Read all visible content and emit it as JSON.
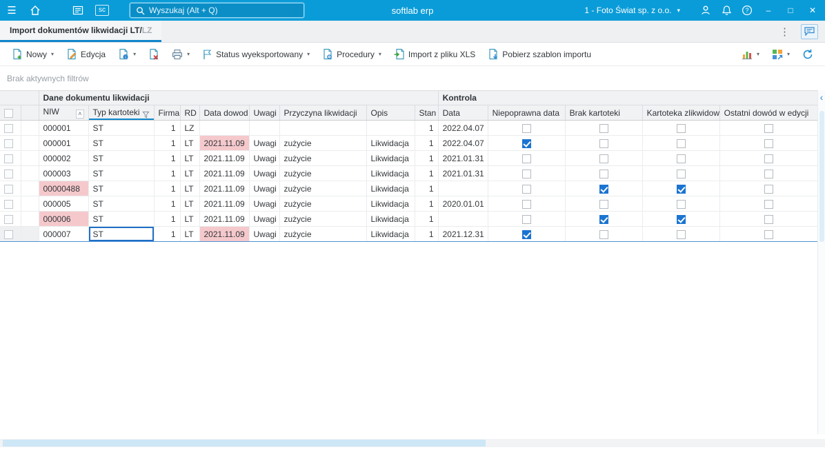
{
  "topbar": {
    "search_placeholder": "Wyszukaj (Alt + Q)",
    "app_name": "softlab erp",
    "company": "1 - Foto Świat sp. z o.o."
  },
  "tabbar": {
    "title": "Import dokumentów likwidacji LT/",
    "title_suffix": "LZ"
  },
  "toolbar": {
    "nowy": "Nowy",
    "edycja": "Edycja",
    "status": "Status wyeksportowany",
    "procedury": "Procedury",
    "import_xls": "Import z pliku XLS",
    "pobierz": "Pobierz szablon importu"
  },
  "filterbar": {
    "text": "Brak aktywnych filtrów"
  },
  "grid": {
    "group_headers": {
      "dane": "Dane dokumentu likwidacji",
      "kontrola": "Kontrola"
    },
    "columns": [
      {
        "key": "niw",
        "label": "NIW",
        "sort": "asc"
      },
      {
        "key": "typ",
        "label": "Typ kartoteki",
        "filter": true
      },
      {
        "key": "firma",
        "label": "Firma",
        "align": "right"
      },
      {
        "key": "rd",
        "label": "RD"
      },
      {
        "key": "data_dowodu",
        "label": "Data dowod"
      },
      {
        "key": "uwagi",
        "label": "Uwagi"
      },
      {
        "key": "przyczyna",
        "label": "Przyczyna likwidacji"
      },
      {
        "key": "opis",
        "label": "Opis"
      },
      {
        "key": "stan",
        "label": "Stan",
        "align": "right"
      },
      {
        "key": "data",
        "label": "Data"
      },
      {
        "key": "niepoprawna_data",
        "label": "Niepoprawna data",
        "type": "checkbox"
      },
      {
        "key": "brak_kartoteki",
        "label": "Brak kartoteki",
        "type": "checkbox"
      },
      {
        "key": "kartoteka_zlikw",
        "label": "Kartoteka zlikwidow",
        "type": "checkbox"
      },
      {
        "key": "ostatni_dowod",
        "label": "Ostatni dowód w edycji",
        "type": "checkbox"
      }
    ],
    "rows": [
      {
        "niw": "000001",
        "typ": "ST",
        "firma": "1",
        "rd": "LZ",
        "data_dowodu": "",
        "uwagi": "",
        "przyczyna": "",
        "opis": "",
        "stan": "1",
        "data": "2022.04.07",
        "niepoprawna_data": false,
        "brak_kartoteki": false,
        "kartoteka_zlikw": false,
        "ostatni_dowod": false,
        "highlight": []
      },
      {
        "niw": "000001",
        "typ": "ST",
        "firma": "1",
        "rd": "LT",
        "data_dowodu": "2021.11.09",
        "uwagi": "Uwagi",
        "przyczyna": "zużycie",
        "opis": "Likwidacja",
        "stan": "1",
        "data": "2022.04.07",
        "niepoprawna_data": true,
        "brak_kartoteki": false,
        "kartoteka_zlikw": false,
        "ostatni_dowod": false,
        "highlight": [
          "data_dowodu"
        ]
      },
      {
        "niw": "000002",
        "typ": "ST",
        "firma": "1",
        "rd": "LT",
        "data_dowodu": "2021.11.09",
        "uwagi": "Uwagi",
        "przyczyna": "zużycie",
        "opis": "Likwidacja",
        "stan": "1",
        "data": "2021.01.31",
        "niepoprawna_data": false,
        "brak_kartoteki": false,
        "kartoteka_zlikw": false,
        "ostatni_dowod": false,
        "highlight": []
      },
      {
        "niw": "000003",
        "typ": "ST",
        "firma": "1",
        "rd": "LT",
        "data_dowodu": "2021.11.09",
        "uwagi": "Uwagi",
        "przyczyna": "zużycie",
        "opis": "Likwidacja",
        "stan": "1",
        "data": "2021.01.31",
        "niepoprawna_data": false,
        "brak_kartoteki": false,
        "kartoteka_zlikw": false,
        "ostatni_dowod": false,
        "highlight": []
      },
      {
        "niw": "00000488",
        "typ": "ST",
        "firma": "1",
        "rd": "LT",
        "data_dowodu": "2021.11.09",
        "uwagi": "Uwagi",
        "przyczyna": "zużycie",
        "opis": "Likwidacja",
        "stan": "1",
        "data": "",
        "niepoprawna_data": false,
        "brak_kartoteki": true,
        "kartoteka_zlikw": true,
        "ostatni_dowod": false,
        "highlight": [
          "niw"
        ]
      },
      {
        "niw": "000005",
        "typ": "ST",
        "firma": "1",
        "rd": "LT",
        "data_dowodu": "2021.11.09",
        "uwagi": "Uwagi",
        "przyczyna": "zużycie",
        "opis": "Likwidacja",
        "stan": "1",
        "data": "2020.01.01",
        "niepoprawna_data": false,
        "brak_kartoteki": false,
        "kartoteka_zlikw": false,
        "ostatni_dowod": false,
        "highlight": []
      },
      {
        "niw": "000006",
        "typ": "ST",
        "firma": "1",
        "rd": "LT",
        "data_dowodu": "2021.11.09",
        "uwagi": "Uwagi",
        "przyczyna": "zużycie",
        "opis": "Likwidacja",
        "stan": "1",
        "data": "",
        "niepoprawna_data": false,
        "brak_kartoteki": true,
        "kartoteka_zlikw": true,
        "ostatni_dowod": false,
        "highlight": [
          "niw"
        ]
      },
      {
        "niw": "000007",
        "typ": "ST",
        "firma": "1",
        "rd": "LT",
        "data_dowodu": "2021.11.09",
        "uwagi": "Uwagi",
        "przyczyna": "zużycie",
        "opis": "Likwidacja",
        "stan": "1",
        "data": "2021.12.31",
        "niepoprawna_data": true,
        "brak_kartoteki": false,
        "kartoteka_zlikw": false,
        "ostatni_dowod": false,
        "highlight": [
          "data_dowodu"
        ]
      }
    ],
    "selected_row_index": 7,
    "editing_cell": "typ"
  },
  "icons": {
    "menu": "☰",
    "chevron_down": "▾",
    "overflow_menu": "⋮",
    "sc_badge": "sc",
    "sort_asc": "˄",
    "collapse_panel": "‹",
    "minimize": "–",
    "maximize": "□",
    "close": "✕"
  },
  "colors": {
    "topbar": "#0a9cd8",
    "accent": "#0f86cc",
    "selection_border": "#4e92d5",
    "checkbox_checked": "#1b74d1",
    "error_cell": "#f5c9cc"
  }
}
